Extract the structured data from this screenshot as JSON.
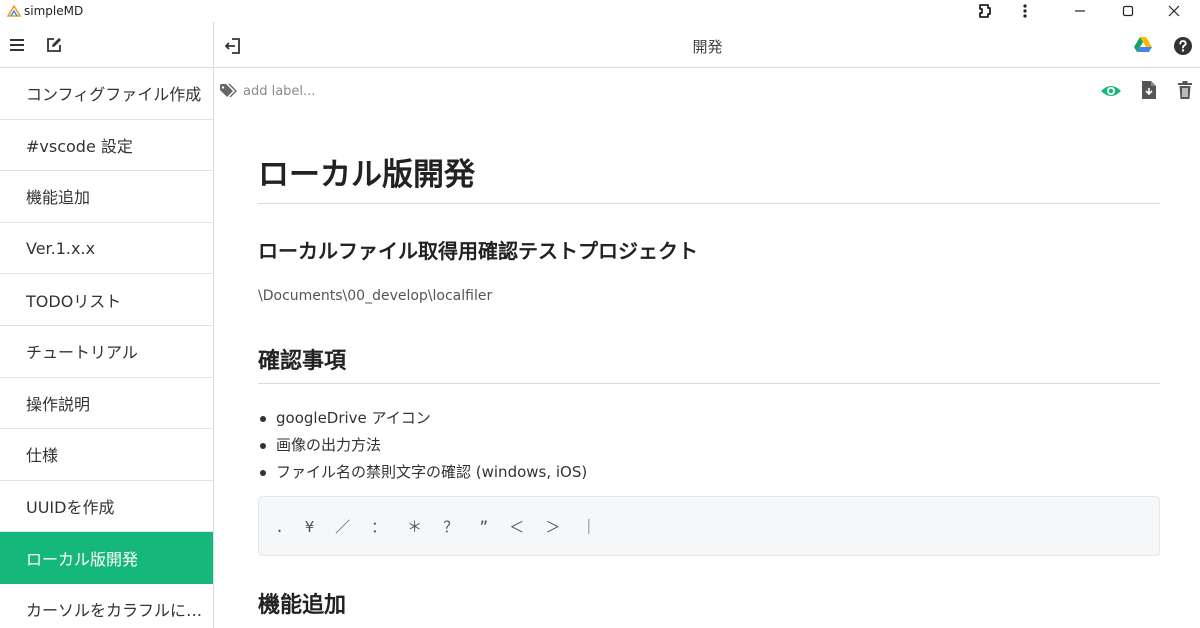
{
  "window": {
    "app_title": "simpleMD"
  },
  "colors": {
    "accent": "#16b77a",
    "gdrive_green": "#1aa260",
    "gdrive_yellow": "#fbbc04",
    "gdrive_blue": "#4285f4"
  },
  "sidebar": {
    "items": [
      {
        "label": "コンフィグファイル作成"
      },
      {
        "label": "#vscode 設定"
      },
      {
        "label": "機能追加"
      },
      {
        "label": "Ver.1.x.x"
      },
      {
        "label": "TODOリスト"
      },
      {
        "label": "チュートリアル"
      },
      {
        "label": "操作説明"
      },
      {
        "label": "仕様"
      },
      {
        "label": "UUIDを作成"
      },
      {
        "label": "ローカル版開発",
        "active": true
      },
      {
        "label": "カーソルをカラフルにする"
      }
    ]
  },
  "header": {
    "title": "開発"
  },
  "labels": {
    "placeholder": "add label..."
  },
  "document": {
    "h1": "ローカル版開発",
    "h3": "ローカルファイル取得用確認テストプロジェクト",
    "path": "\\Documents\\00_develop\\localfiler",
    "h2": "確認事項",
    "bullets": [
      "googleDrive アイコン",
      "画像の出力方法",
      "ファイル名の禁則文字の確認 (windows, iOS)"
    ],
    "code": ". ¥ ／ ： ＊ ？ ” ＜ ＞ ｜",
    "h2b": "機能追加"
  }
}
